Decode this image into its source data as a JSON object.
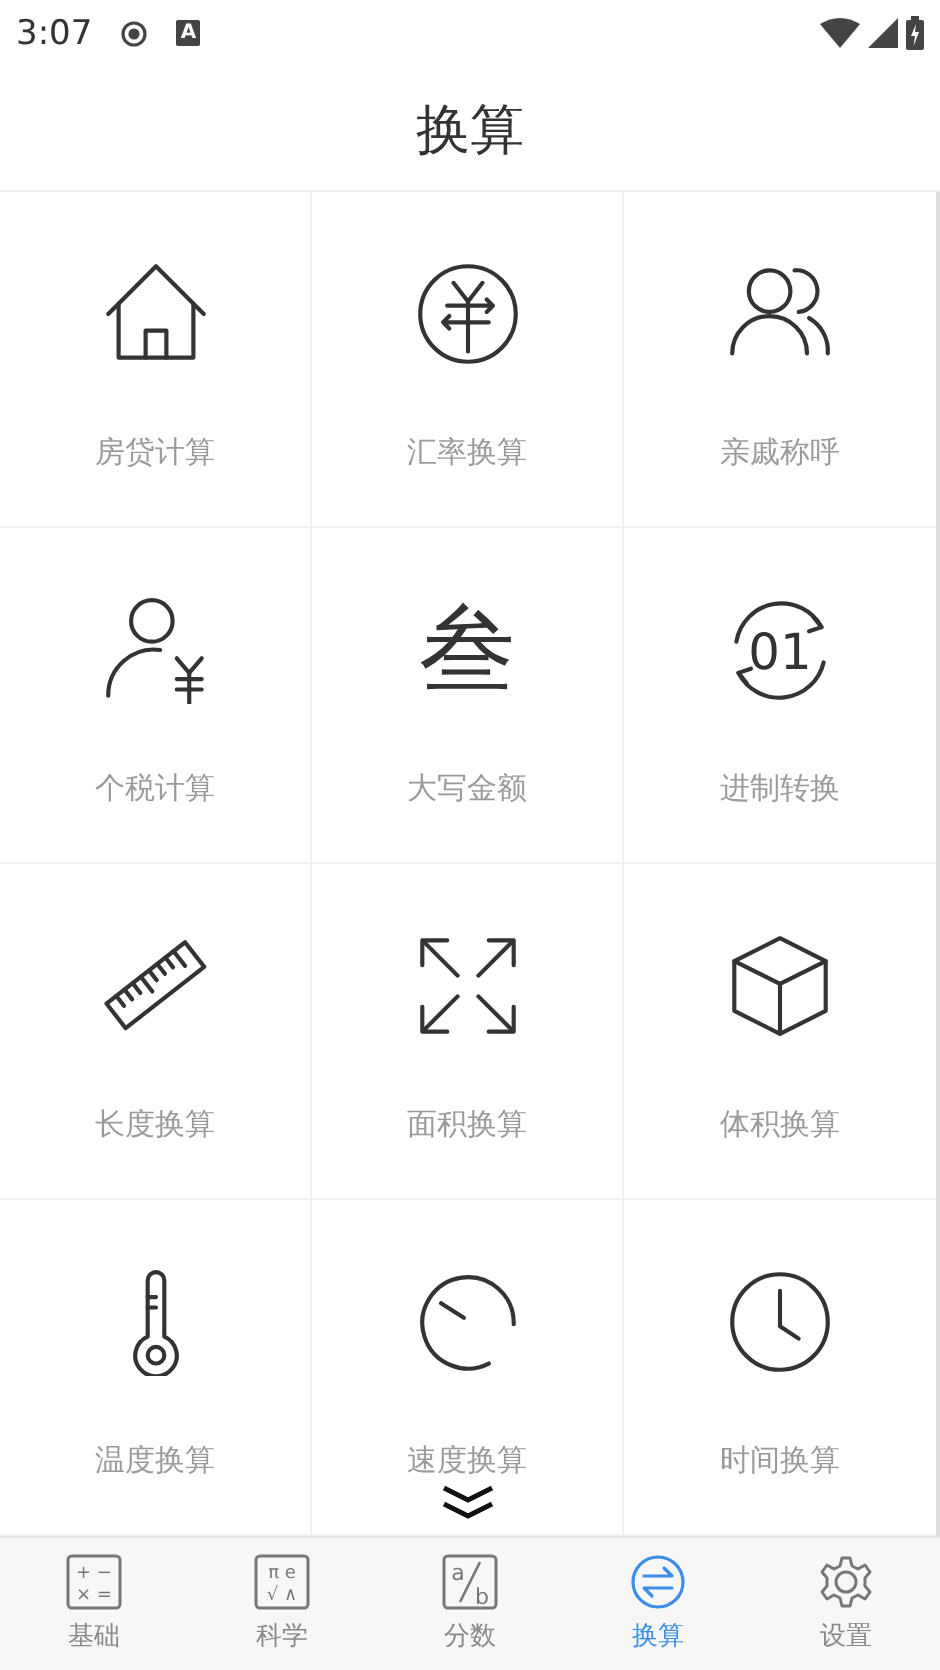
{
  "status_bar": {
    "time": "3:07",
    "notification_letter": "A"
  },
  "header": {
    "title": "换算"
  },
  "tools": [
    {
      "label": "房贷计算",
      "kind": "house"
    },
    {
      "label": "汇率换算",
      "kind": "currency"
    },
    {
      "label": "亲戚称呼",
      "kind": "people"
    },
    {
      "label": "个税计算",
      "kind": "tax"
    },
    {
      "label": "大写金额",
      "kind": "glyph",
      "glyph": "叁"
    },
    {
      "label": "进制转换",
      "kind": "cycle",
      "glyph": "01"
    },
    {
      "label": "长度换算",
      "kind": "ruler"
    },
    {
      "label": "面积换算",
      "kind": "area"
    },
    {
      "label": "体积换算",
      "kind": "cube"
    },
    {
      "label": "温度换算",
      "kind": "temperature"
    },
    {
      "label": "速度换算",
      "kind": "speed"
    },
    {
      "label": "时间换算",
      "kind": "clock"
    }
  ],
  "tab_bar": [
    {
      "label": "基础",
      "kind": "keypad",
      "glyphs": [
        "+ −",
        "× ="
      ],
      "selected": false
    },
    {
      "label": "科学",
      "kind": "keypad",
      "glyphs": [
        "π e",
        "√ ∧"
      ],
      "selected": false
    },
    {
      "label": "分数",
      "kind": "fraction",
      "glyphs": [
        "a",
        "b"
      ],
      "selected": false
    },
    {
      "label": "换算",
      "kind": "swap",
      "selected": true
    },
    {
      "label": "设置",
      "kind": "gear",
      "selected": false
    }
  ]
}
